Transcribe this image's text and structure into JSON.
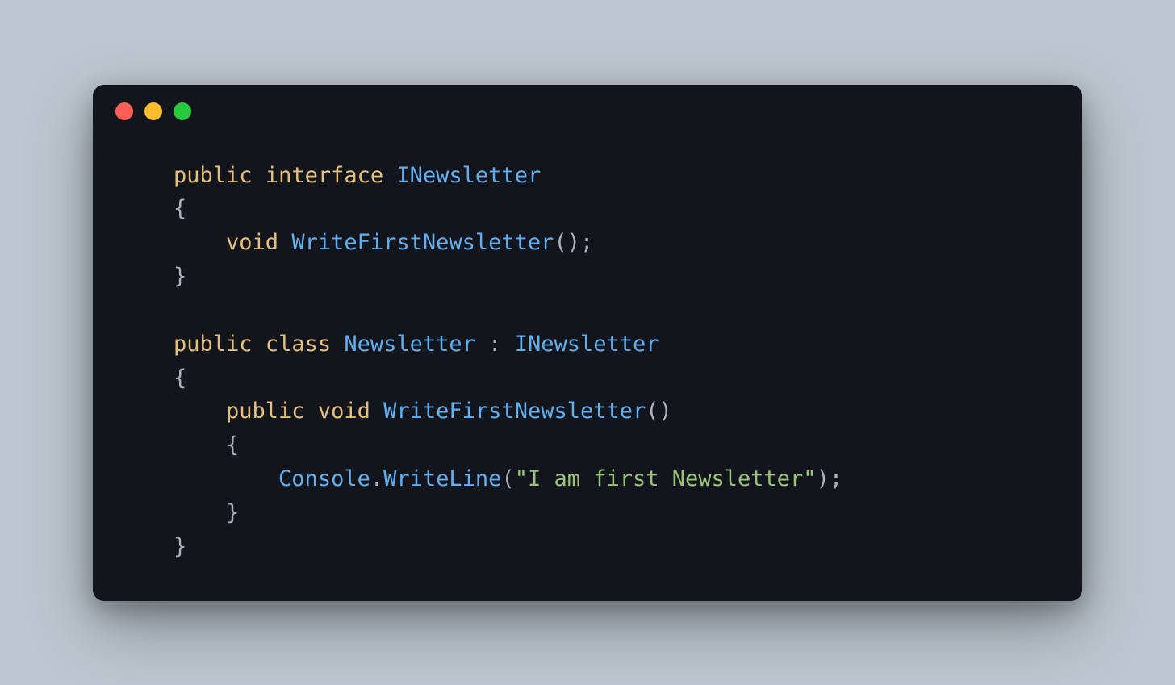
{
  "colors": {
    "background": "#bec7d1",
    "window": "#13151c",
    "keyword": "#e5c07b",
    "type": "#61afef",
    "plain": "#abb2bf",
    "string": "#98c379",
    "traffic_red": "#ff5f56",
    "traffic_yellow": "#ffbd2e",
    "traffic_green": "#27c93f"
  },
  "tokens": {
    "kw_public": "public",
    "kw_interface": "interface",
    "kw_class": "class",
    "kw_void": "void",
    "type_INewsletter": "INewsletter",
    "type_Newsletter": "Newsletter",
    "type_Console": "Console",
    "method_WriteFirstNewsletter": "WriteFirstNewsletter",
    "method_WriteLine": "WriteLine",
    "brace_open": "{",
    "brace_close": "}",
    "paren_open": "(",
    "paren_close": ")",
    "semi": ";",
    "colon": " : ",
    "dot": ".",
    "space": " ",
    "indent1": "    ",
    "indent2": "        ",
    "string_lit": "\"I am first Newsletter\""
  }
}
